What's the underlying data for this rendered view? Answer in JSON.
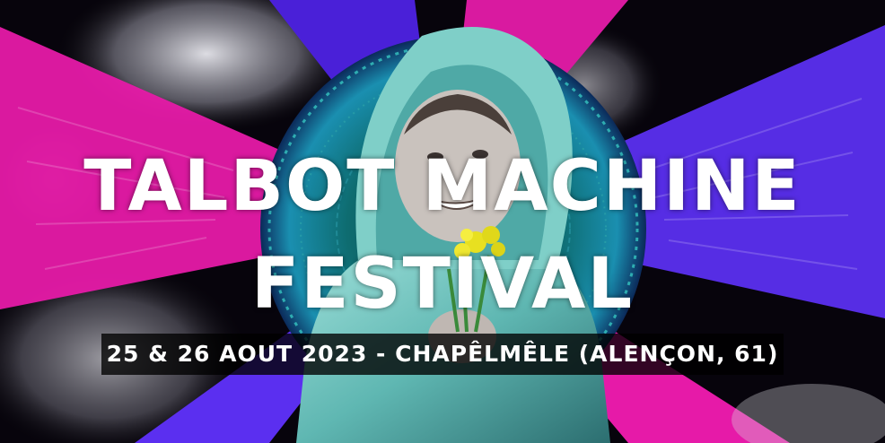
{
  "banner": {
    "title_line_1": "TALBOT MACHINE",
    "title_line_2": "FESTIVAL",
    "date_location": "25 & 26 AOUT 2023 - CHAPÊLMÊLE (ALENÇON, 61)"
  },
  "colors": {
    "magenta": "#e61aa8",
    "violet": "#5b2ff0",
    "teal_halo": "#1fb7b0",
    "raincoat": "#6fc7c0",
    "flowers": "#e8e020",
    "text": "#ffffff"
  }
}
